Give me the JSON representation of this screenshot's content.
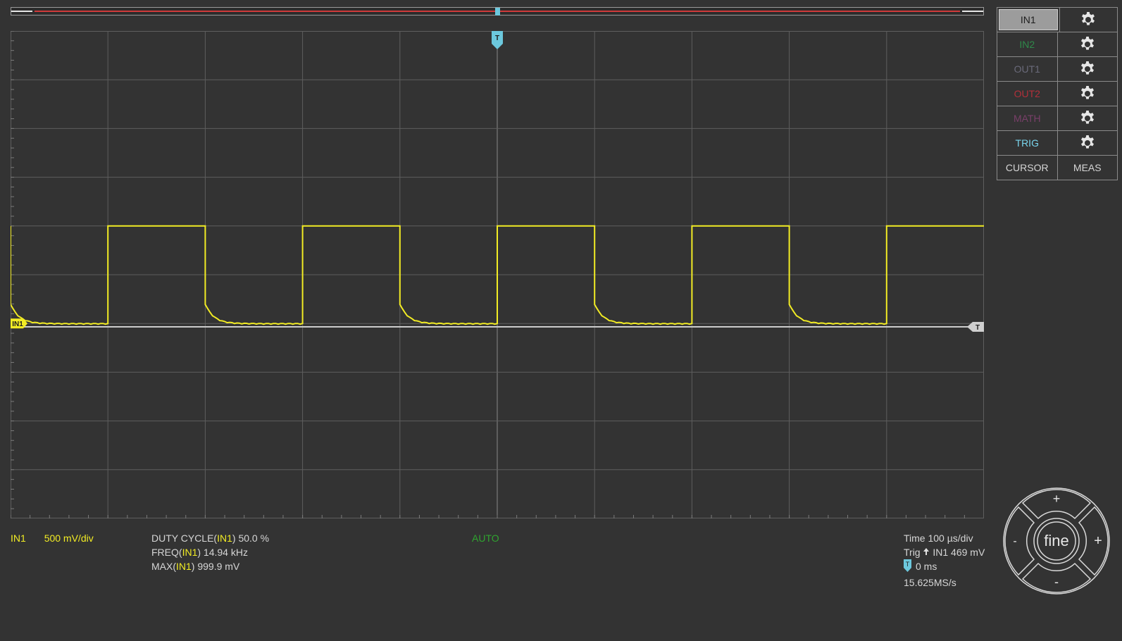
{
  "channels": [
    {
      "label": "IN1",
      "color": "#1e1e1e",
      "active": true
    },
    {
      "label": "IN2",
      "color": "#2f8a4a",
      "active": false
    },
    {
      "label": "OUT1",
      "color": "#6a6a7a",
      "active": false
    },
    {
      "label": "OUT2",
      "color": "#b3303a",
      "active": false
    },
    {
      "label": "MATH",
      "color": "#7a3f6a",
      "active": false
    },
    {
      "label": "TRIG",
      "color": "#7ad6ee",
      "active": false
    }
  ],
  "panel": {
    "cursor": "CURSOR",
    "meas": "MEAS"
  },
  "plot": {
    "trigger_marker": "T",
    "trigger_level_marker": "T",
    "channel_marker": "IN1",
    "grid": {
      "h_divisions": 10,
      "v_divisions": 10
    }
  },
  "signal": {
    "channel": "IN1",
    "scale": "500 mV/div",
    "high_level_divs": 1.0,
    "low_level_divs": -1.0,
    "period_divs": 2.0,
    "color": "#f2ec24"
  },
  "measurements": [
    {
      "name": "DUTY CYCLE(",
      "ch": "IN1",
      "rest": ") 50.0 %"
    },
    {
      "name": "FREQ(",
      "ch": "IN1",
      "rest": ") 14.94 kHz"
    },
    {
      "name": "MAX(",
      "ch": "IN1",
      "rest": ") 999.9 mV"
    }
  ],
  "mode": "AUTO",
  "timebase": {
    "time": "Time 100 µs/div",
    "trig_prefix": "Trig",
    "trig_value": "IN1 469 mV",
    "trig_badge": "T",
    "offset": "0 ms",
    "rate": "15.625MS/s"
  },
  "joystick": {
    "center": "fine",
    "up": "+",
    "down": "-",
    "left": "-",
    "right": "+"
  },
  "colors": {
    "trigger": "#6cc8dd",
    "grid": "#5e5e5e",
    "trace": "#f2ec24",
    "trig_level": "#cccccc"
  }
}
